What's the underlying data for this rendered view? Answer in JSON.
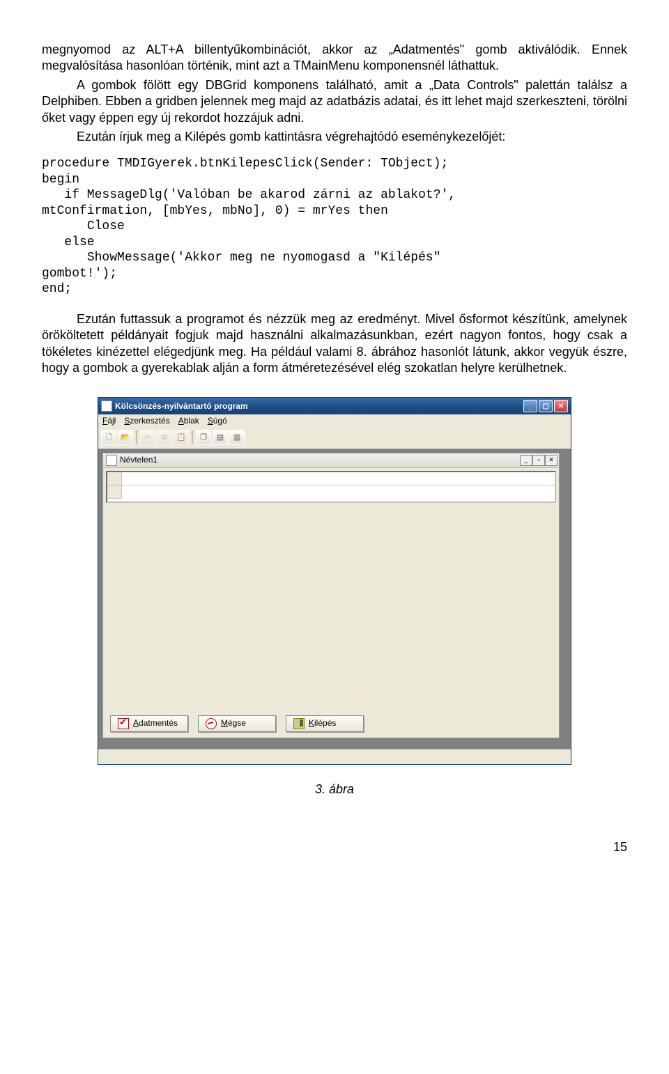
{
  "para1": "megnyomod az ALT+A billentyűkombinációt, akkor az „Adatmentés\" gomb aktiválódik. Ennek megvalósítása hasonlóan történik, mint azt a TMainMenu komponensnél láthattuk.",
  "para2": "A gombok fölött egy DBGrid komponens található, amit a „Data Controls\" palettán találsz a Delphiben. Ebben a gridben jelennek meg majd az adatbázis adatai, és itt lehet majd szerkeszteni, törölni őket vagy éppen egy új rekordot hozzájuk adni.",
  "para3": "Ezután írjuk meg a Kilépés gomb kattintásra végrehajtódó eseménykezelőjét:",
  "code": "procedure TMDIGyerek.btnKilepesClick(Sender: TObject);\nbegin\n   if MessageDlg('Valóban be akarod zárni az ablakot?',\nmtConfirmation, [mbYes, mbNo], 0) = mrYes then\n      Close\n   else\n      ShowMessage('Akkor meg ne nyomogasd a \"Kilépés\"\ngombot!');\nend;",
  "para4": "Ezután futtassuk a programot és nézzük meg az eredményt. Mivel ősformot készítünk, amelynek örököltetett példányait fogjuk majd használni alkalmazásunkban, ezért nagyon fontos, hogy csak a tökéletes kinézettel elégedjünk meg. Ha például valami 8. ábrához hasonlót látunk, akkor vegyük észre, hogy a gombok a gyerekablak alján a form átméretezésével elég szokatlan helyre kerülhetnek.",
  "app": {
    "title": "Kölcsönzés-nyilvántartó program",
    "menus": {
      "file": "Fájl",
      "edit": "Szerkesztés",
      "window": "Ablak",
      "help": "Súgó"
    },
    "child_title": "Névtelen1",
    "buttons": {
      "save": "Adatmentés",
      "cancel": "Mégse",
      "exit": "Kilépés"
    }
  },
  "figure_caption": "3. ábra",
  "page_number": "15"
}
